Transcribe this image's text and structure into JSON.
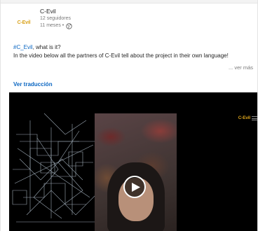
{
  "company": {
    "logo_text": "C-Evil",
    "name": "C-Evil",
    "followers": "12 seguidores",
    "time": "11 meses •"
  },
  "post": {
    "hashtag": "#C_Evil",
    "title_rest": ", what is it?",
    "body": "In the video below all the partners of C-Evil tell about the project in their own language!",
    "more_label": "... ver más"
  },
  "translate_label": "Ver traducción",
  "video": {
    "watermark": "C-Evil"
  }
}
